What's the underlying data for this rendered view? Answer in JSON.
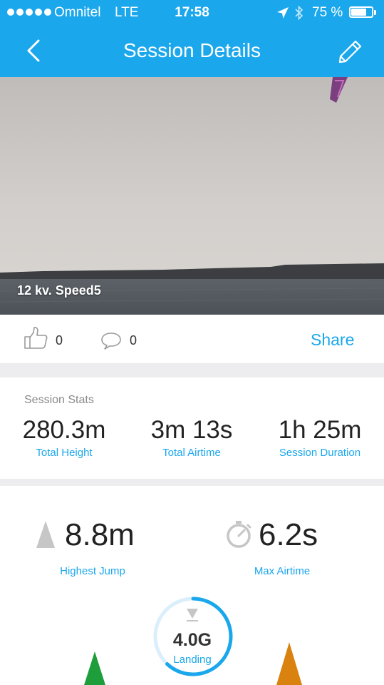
{
  "status_bar": {
    "carrier": "Omnitel",
    "network": "LTE",
    "time": "17:58",
    "battery_percent": "75 %",
    "battery_level": 0.75
  },
  "nav": {
    "title": "Session Details",
    "back_icon": "chevron-left-icon",
    "edit_icon": "pencil-icon"
  },
  "photo": {
    "caption": "12 kv. Speed5"
  },
  "social": {
    "likes": "0",
    "comments": "0",
    "share_label": "Share"
  },
  "session_stats": {
    "title": "Session Stats",
    "items": [
      {
        "value": "280.3m",
        "label": "Total Height"
      },
      {
        "value": "3m 13s",
        "label": "Total Airtime"
      },
      {
        "value": "1h 25m",
        "label": "Session Duration"
      }
    ]
  },
  "highlights": {
    "highest_jump": {
      "value": "8.8m",
      "label": "Highest Jump"
    },
    "max_airtime": {
      "value": "6.2s",
      "label": "Max Airtime"
    },
    "landing": {
      "value": "4.0G",
      "label": "Landing",
      "gauge_fraction": 0.62
    }
  },
  "colors": {
    "accent": "#1aa7ec",
    "divider": "#ededf0",
    "marker_left": "#1e9e3a",
    "marker_right": "#d9820f"
  }
}
